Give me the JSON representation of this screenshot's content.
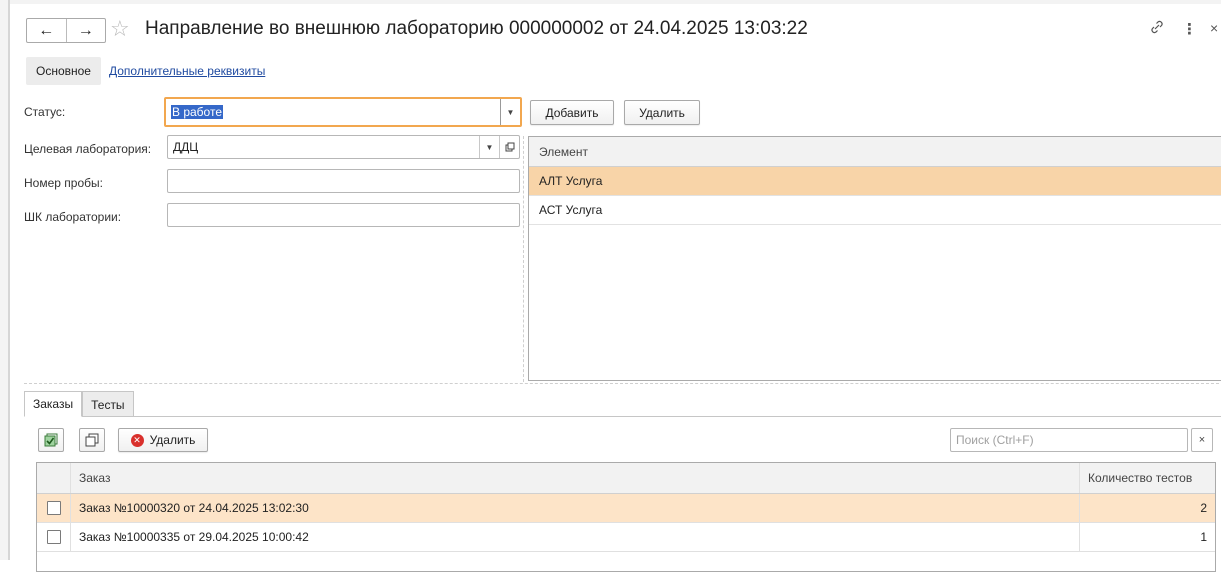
{
  "header": {
    "title": "Направление во внешнюю лабораторию 000000002 от 24.04.2025 13:03:22",
    "back_glyph": "←",
    "forward_glyph": "→",
    "star_glyph": "☆",
    "link_glyph": "🔗",
    "more_glyph": "⋮",
    "close_glyph": "×"
  },
  "form_tabs": [
    {
      "label": "Основное"
    },
    {
      "label": "Дополнительные реквизиты"
    }
  ],
  "fields": {
    "status_label": "Статус:",
    "status_value": "В работе",
    "lab_label": "Целевая лаборатория:",
    "lab_value": "ДДЦ",
    "sample_label": "Номер пробы:",
    "sample_value": "",
    "barcode_label": "ШК лаборатории:",
    "barcode_value": ""
  },
  "elements": {
    "add_label": "Добавить",
    "delete_label": "Удалить",
    "column": "Элемент",
    "rows": [
      "АЛТ Услуга",
      "АСТ Услуга"
    ]
  },
  "bottom_tabs": [
    {
      "label": "Заказы"
    },
    {
      "label": "Тесты"
    }
  ],
  "orders_toolbar": {
    "delete_label": "Удалить",
    "search_placeholder": "Поиск (Ctrl+F)",
    "clear_glyph": "×"
  },
  "orders": {
    "col_order": "Заказ",
    "col_count": "Количество тестов",
    "rows": [
      {
        "order": "Заказ №10000320 от 24.04.2025 13:02:30",
        "count": "2"
      },
      {
        "order": "Заказ №10000335 от 29.04.2025 10:00:42",
        "count": "1"
      }
    ]
  },
  "colors": {
    "selection_row": "#f8d4a8",
    "focus_border": "#f2a74f",
    "link": "#1f4aa0"
  }
}
